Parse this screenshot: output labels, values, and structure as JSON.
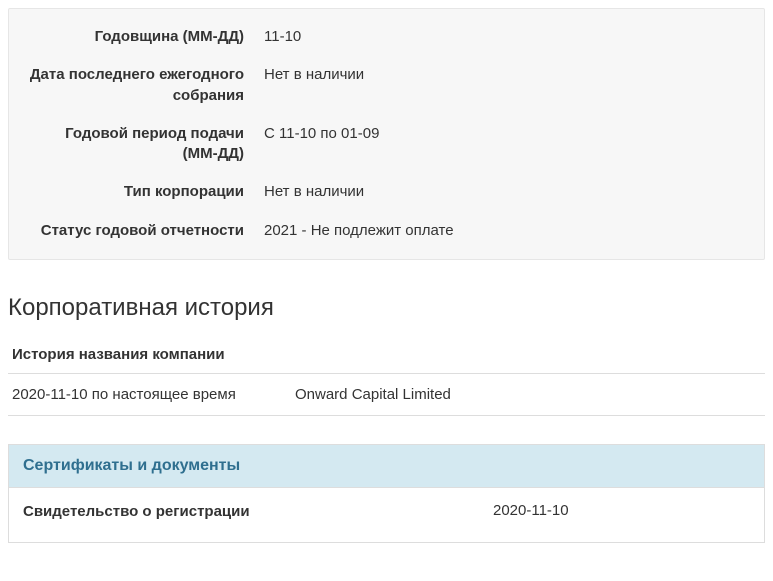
{
  "details": {
    "rows": [
      {
        "label": "Годовщина (ММ-ДД)",
        "value": "11-10"
      },
      {
        "label": "Дата последнего ежегодного собрания",
        "value": "Нет в наличии"
      },
      {
        "label": "Годовой период подачи (ММ-ДД)",
        "value": "С 11-10 по 01-09"
      },
      {
        "label": "Тип корпорации",
        "value": "Нет в наличии"
      },
      {
        "label": "Статус годовой отчетности",
        "value": "2021 - Не подлежит оплате"
      }
    ]
  },
  "history": {
    "section_title": "Корпоративная история",
    "name_history_heading": "История названия компании",
    "rows": [
      {
        "period": "2020-11-10 по настоящее время",
        "name": "Onward Capital Limited"
      }
    ]
  },
  "documents": {
    "heading": "Сертификаты и документы",
    "rows": [
      {
        "label": "Свидетельство о регистрации",
        "date": "2020-11-10"
      }
    ]
  }
}
